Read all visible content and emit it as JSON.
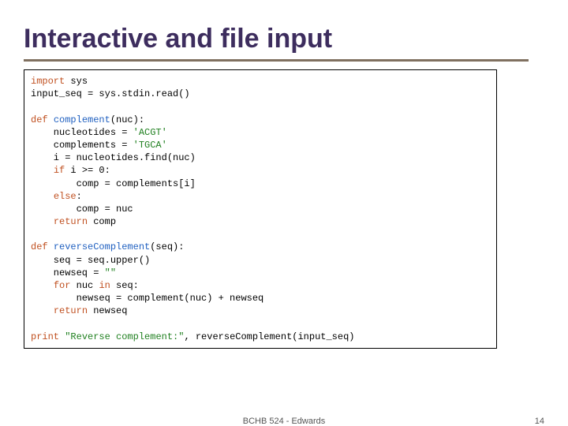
{
  "title": "Interactive and file input",
  "code": {
    "l1a": "import",
    "l1b": " sys",
    "l2": "input_seq = sys.stdin.read()",
    "blank1": "",
    "l3a": "def",
    "l3b": " ",
    "l3c": "complement",
    "l3d": "(nuc):",
    "l4a": "    nucleotides = ",
    "l4b": "'ACGT'",
    "l5a": "    complements = ",
    "l5b": "'TGCA'",
    "l6": "    i = nucleotides.find(nuc)",
    "l7a": "    ",
    "l7b": "if",
    "l7c": " i >= 0:",
    "l8": "        comp = complements[i]",
    "l9a": "    ",
    "l9b": "else",
    "l9c": ":",
    "l10": "        comp = nuc",
    "l11a": "    ",
    "l11b": "return",
    "l11c": " comp",
    "blank2": "",
    "l12a": "def",
    "l12b": " ",
    "l12c": "reverseComplement",
    "l12d": "(seq):",
    "l13": "    seq = seq.upper()",
    "l14a": "    newseq = ",
    "l14b": "\"\"",
    "l15a": "    ",
    "l15b": "for",
    "l15c": " nuc ",
    "l15d": "in",
    "l15e": " seq:",
    "l16": "        newseq = complement(nuc) + newseq",
    "l17a": "    ",
    "l17b": "return",
    "l17c": " newseq",
    "blank3": "",
    "l18a": "print",
    "l18b": " ",
    "l18c": "\"Reverse complement:\"",
    "l18d": ", reverseComplement(input_seq)"
  },
  "footer": {
    "center": "BCHB 524 - Edwards",
    "page": "14"
  }
}
